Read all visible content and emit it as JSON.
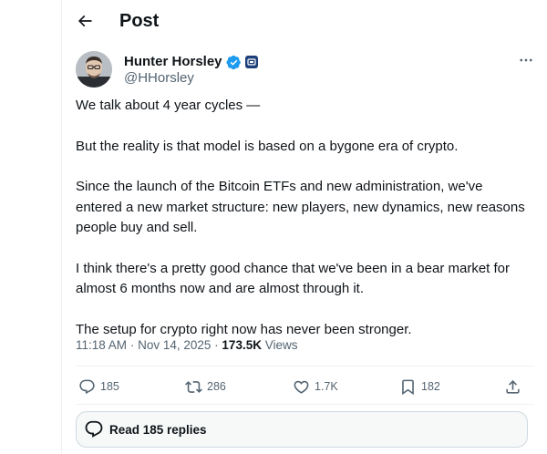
{
  "header": {
    "title": "Post",
    "back_icon": "arrow-left-icon"
  },
  "author": {
    "display_name": "Hunter Horsley",
    "handle": "@HHorsley",
    "verified_icon": "verified-badge-icon",
    "verified_color": "#1d9bf0",
    "affiliation_icon": "affiliate-badge-icon",
    "more_label": "···"
  },
  "tweet": {
    "paragraphs": [
      "We talk about 4 year cycles —",
      "But the reality is that model is based on a bygone era of crypto.",
      "Since the launch of the Bitcoin ETFs and new administration, we've entered a new market structure: new players, new dynamics, new reasons people buy and sell.",
      "I think there's a pretty good chance that we've been in a bear market for almost 6 months now and are almost through it.",
      "The setup for crypto right now has never been stronger."
    ],
    "time": "11:18 AM",
    "date": "Nov 14, 2025",
    "separator": "·",
    "views_count": "173.5K",
    "views_label": "Views"
  },
  "actions": {
    "reply_count": "185",
    "repost_count": "286",
    "like_count": "1.7K",
    "bookmark_count": "182"
  },
  "replies_button": {
    "label": "Read 185 replies"
  },
  "colors": {
    "text": "#0f1419",
    "secondary": "#536471",
    "border": "#eff3f4"
  }
}
